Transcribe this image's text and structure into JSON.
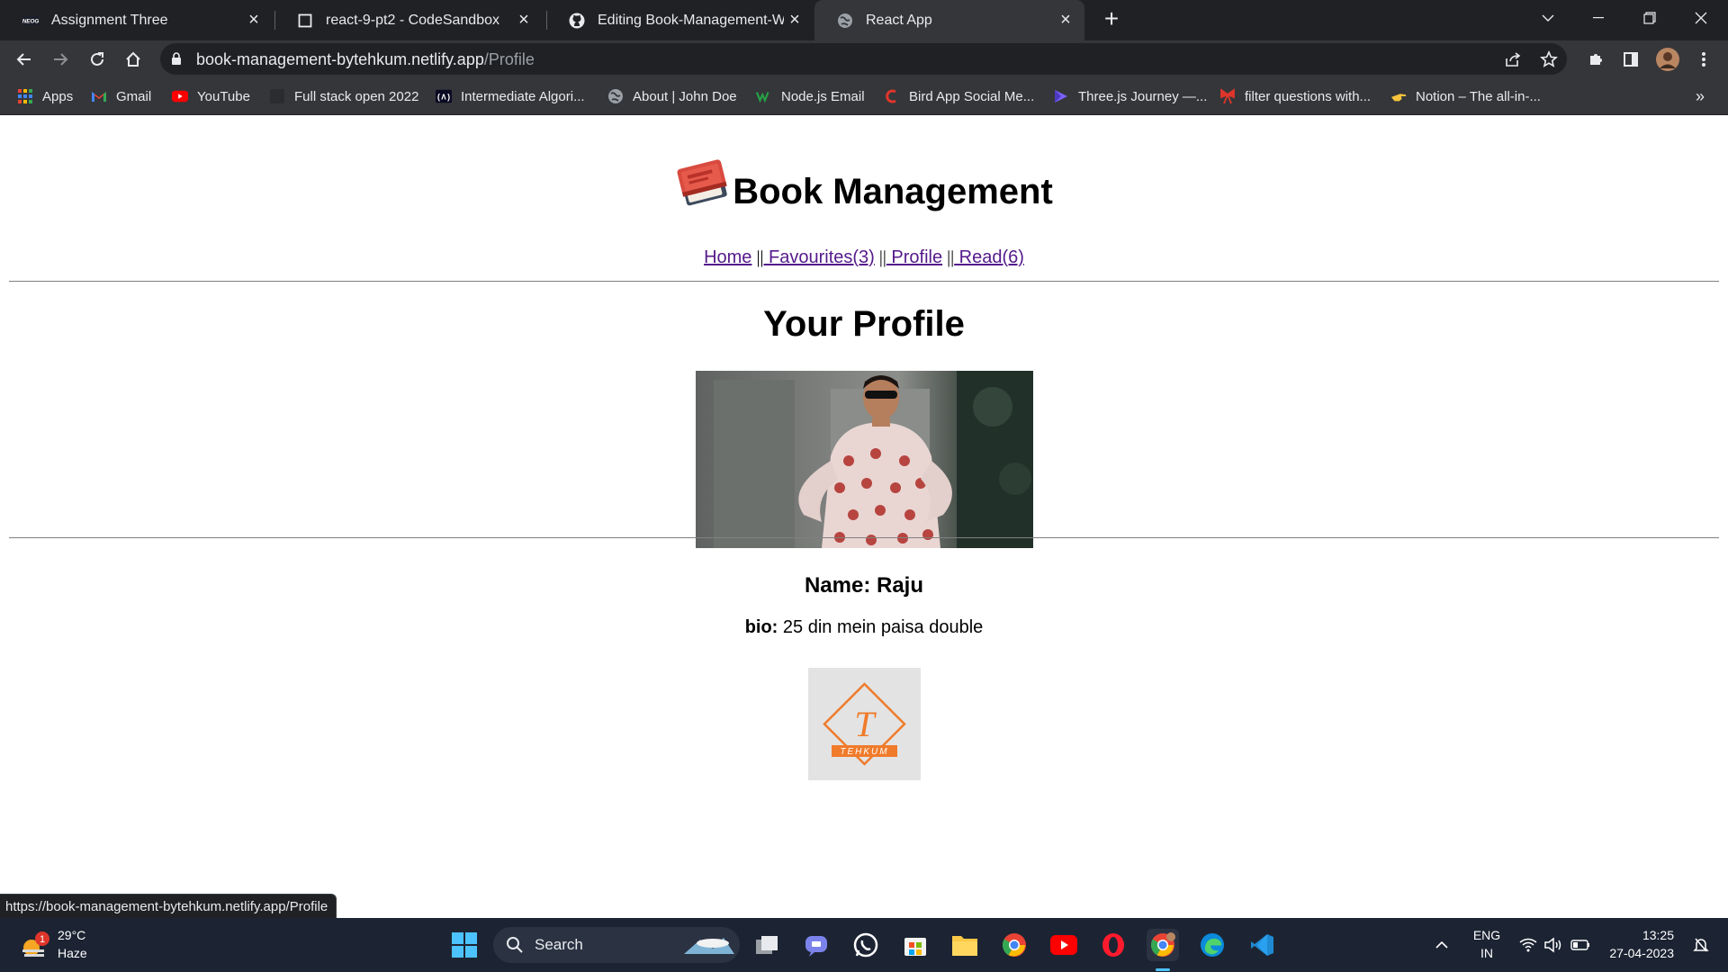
{
  "browser": {
    "tabs": [
      {
        "title": "Assignment Three",
        "icon": "neog-favicon",
        "active": false
      },
      {
        "title": "react-9-pt2 - CodeSandbox",
        "icon": "codesandbox-favicon",
        "active": false
      },
      {
        "title": "Editing Book-Management-Web",
        "icon": "github-favicon",
        "active": false
      },
      {
        "title": "React App",
        "icon": "globe-favicon",
        "active": true
      }
    ],
    "address": {
      "host": "book-management-bytehkum.netlify.app",
      "path": "/Profile"
    },
    "bookmarks": [
      {
        "label": "Apps",
        "icon": "apps-grid-icon"
      },
      {
        "label": "Gmail",
        "icon": "gmail-icon"
      },
      {
        "label": "YouTube",
        "icon": "youtube-icon"
      },
      {
        "label": "Full stack open 2022",
        "icon": "fullstackopen-icon"
      },
      {
        "label": "Intermediate Algori...",
        "icon": "fcc-icon"
      },
      {
        "label": "About | John Doe",
        "icon": "globe-icon"
      },
      {
        "label": "Node.js Email",
        "icon": "nodejs-email-icon"
      },
      {
        "label": "Bird App Social Me...",
        "icon": "bird-app-icon"
      },
      {
        "label": "Three.js Journey —...",
        "icon": "threejs-icon"
      },
      {
        "label": "filter questions with...",
        "icon": "bow-icon"
      },
      {
        "label": "Notion – The all-in-...",
        "icon": "notion-hand-icon"
      }
    ],
    "more_bookmarks": "»",
    "status_url": "https://book-management-bytehkum.netlify.app/Profile"
  },
  "site": {
    "title": "Book Management",
    "nav": [
      {
        "label": "Home"
      },
      {
        "label": " Favourites(3)"
      },
      {
        "label": " Profile"
      },
      {
        "label": " Read(6)"
      }
    ],
    "nav_separator": "||"
  },
  "profile": {
    "heading": "Your Profile",
    "name_label": "Name: Raju",
    "bio_label": "bio:",
    "bio_text": " 25 din mein paisa double"
  },
  "footer": {
    "logo_letter": "T",
    "logo_text": "TEHKUM",
    "accent": "#f07b2b"
  },
  "taskbar": {
    "weather_badge": "1",
    "temperature": "29°C",
    "condition": "Haze",
    "search_placeholder": "Search",
    "language_line1": "ENG",
    "language_line2": "IN",
    "time": "13:25",
    "date": "27-04-2023"
  }
}
